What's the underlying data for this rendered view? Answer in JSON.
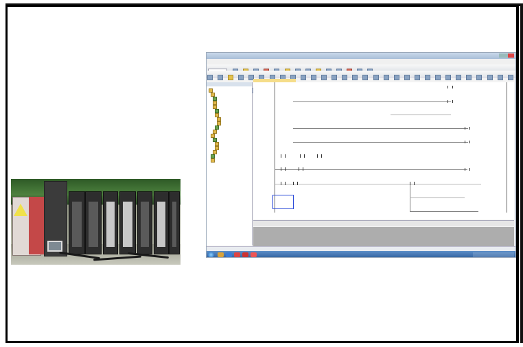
{
  "slide": {
    "background": "#ffffff",
    "frame_color": "#000000"
  },
  "plc_photo": {
    "description_icon": "plc-rack-photo",
    "module_count": 7
  },
  "software_screenshot": {
    "window_title": "",
    "menu_items": [
      "",
      "",
      "",
      "",
      "",
      "",
      "",
      "",
      ""
    ],
    "navigator_tabs": [
      "",
      "",
      ""
    ],
    "accent_colors": {
      "title_bar": "#a9bfd8",
      "nav_tab_active": "#e8a52a",
      "nav_tab_other": "#8a9ab8",
      "cursor": "#2848d8",
      "output_pane": "#adadad",
      "taskbar": "#2f5f9c"
    }
  }
}
